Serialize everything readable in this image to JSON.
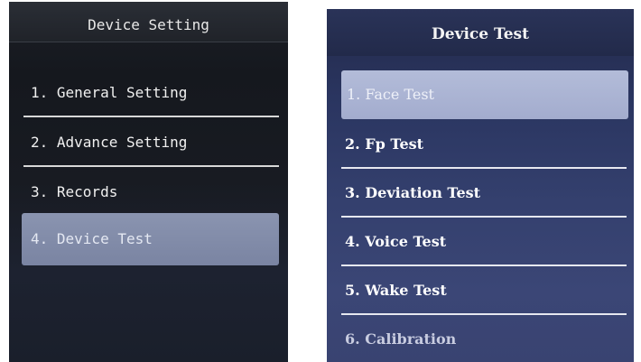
{
  "left_screen": {
    "title": "Device Setting",
    "items": [
      {
        "label": "1. General Setting"
      },
      {
        "label": "2. Advance Setting"
      },
      {
        "label": "3. Records"
      },
      {
        "label": "4. Device Test"
      }
    ],
    "selected_item": "4. Device Test"
  },
  "right_screen": {
    "title": "Device Test",
    "items": [
      {
        "label": "1. Face Test"
      },
      {
        "label": "2. Fp Test"
      },
      {
        "label": "3. Deviation Test"
      },
      {
        "label": "4. Voice Test"
      },
      {
        "label": "5. Wake Test"
      },
      {
        "label": "6. Calibration"
      }
    ],
    "selected_item": "1. Face Test"
  },
  "colors": {
    "left_selection": "#8a94b0",
    "right_selection": "#b3bcd9",
    "right_background": "#34406e",
    "left_background": "#181b22"
  }
}
